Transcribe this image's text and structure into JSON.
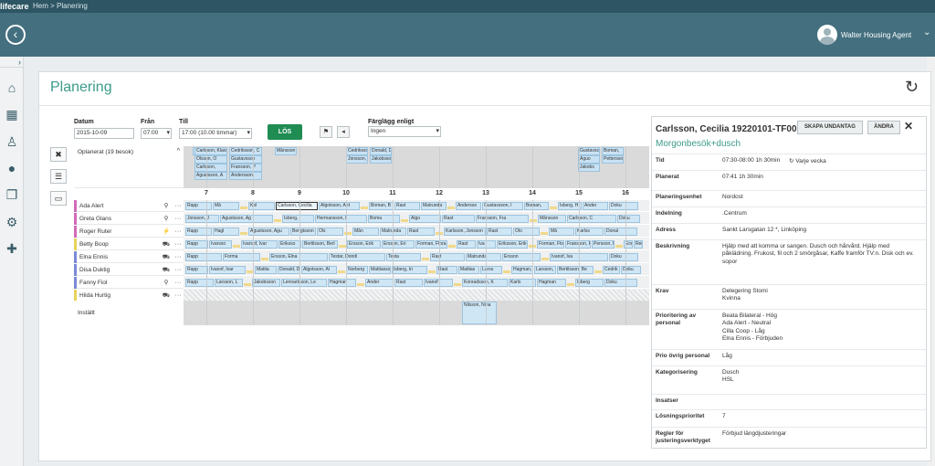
{
  "topbar": {
    "brand": "lifecare",
    "breadcrumb": "Hem  >  Planering"
  },
  "header": {
    "user_name": "Walter Housing Agent"
  },
  "page": {
    "title": "Planering"
  },
  "filters": {
    "datum_label": "Datum",
    "datum_value": "2015-10-09",
    "fran_label": "Från",
    "fran_value": "07:00",
    "till_label": "Till",
    "till_value": "17:00 (10.00 timmar)",
    "los_label": "LÖS",
    "fargsatt_label": "Färglägg enligt",
    "fargsatt_value": "Ingen"
  },
  "schedule": {
    "unplanned_label": "Oplanerat (19 besok)",
    "hours": [
      "7",
      "8",
      "9",
      "10",
      "11",
      "12",
      "13",
      "14",
      "15",
      "16"
    ],
    "installt_label": "Inställt",
    "installt_booking": "Nilsson, Nina",
    "unplanned_blocks": [
      [
        "A",
        "Carlsson, Klara",
        "Cedriksson, C",
        "Olsson, O",
        "Gustavsson",
        "Carlsson,",
        "Fransson, P",
        "Agustsson, A",
        "Andersson"
      ],
      [
        "Månsson"
      ],
      [
        "Cedriksson, C",
        "Donald, Davi",
        "Jonsson, J",
        "Jakobsson, Ja"
      ],
      [
        "Gustavss",
        "Boman,",
        "Aguo",
        "Pettersson",
        "Jakobs"
      ]
    ],
    "staff": [
      {
        "name": "Ada Alert",
        "vehicle": "bike",
        "color": "#d16ab8",
        "bookings": [
          "Rapp",
          "Må",
          "Kol",
          "Carlsson, Cecilia",
          "Algotsson, Ant",
          "Boman, B",
          "Rast",
          "Matrunda",
          "Andersso",
          "Gustavsson, I",
          "Boman,",
          "Isberg, H",
          "Ander",
          "Doku"
        ]
      },
      {
        "name": "Greta Glans",
        "vehicle": "bike",
        "color": "#d16ab8",
        "bookings": [
          "Jonsson, J",
          "Agustsson, Ag",
          "Isberg,",
          "Hermansson, I",
          "Boma",
          "Algo",
          "Rast",
          "Fransson, Fra",
          "Månsson",
          "Carlsson, C",
          "Doku"
        ]
      },
      {
        "name": "Roger Ruter",
        "vehicle": "scooter",
        "color": "#d16ab8",
        "bookings": [
          "Rapp",
          "Hagl",
          "Agustsson, Agu",
          "Bengtsson",
          "Ols",
          "Mån",
          "Matrunda",
          "Rast",
          "Karlsson, Jonsson",
          "Rast",
          "Olo",
          "Må",
          "Karlss",
          "Donal"
        ]
      },
      {
        "name": "Betty Boop",
        "vehicle": "car",
        "color": "#e8d35a",
        "bookings": [
          "Rapp",
          "Ivarsso",
          "Ivarsof, Ivar",
          "Eriksso",
          "Bertilsson, Berl",
          "Ersson, Erik",
          "Ersson, Eri",
          "Forman, Flora",
          "Rast",
          "Iva",
          "Eriksson, Erik",
          "Forman, Flora",
          "Fransson, Frida",
          "Persson, Fr",
          "Ersson, E",
          "Rentni"
        ]
      },
      {
        "name": "Elna Ennis",
        "vehicle": "car",
        "color": "#7b8ad6",
        "bookings": [
          "Rapp",
          "Forma",
          "Ersson, Elna",
          "Testar, Dondi",
          "Testa",
          "Rast",
          "Matrunda",
          "Ersson",
          "Ivanof, Iva",
          "Doku"
        ]
      },
      {
        "name": "Disa Duktig",
        "vehicle": "car",
        "color": "#7b8ad6",
        "bookings": [
          "Rapp",
          "Ivanof, Ivar",
          "Mattia",
          "Donald, D",
          "Algotsson, Al",
          "Norberg",
          "Mattiasso",
          "Isberg, Iri",
          "Rast",
          "Mattias",
          "Larss",
          "Hagman,",
          "Larsson,",
          "Bertilsson, Be",
          "Cedrik",
          "Doku"
        ]
      },
      {
        "name": "Fanny Fiol",
        "vehicle": "bike",
        "color": "#7b8ad6",
        "bookings": [
          "Rapp",
          "Larsson, L",
          "Jakobsson",
          "Lennartsson, Le",
          "Hagman",
          "Ander",
          "Rast",
          "Ivanof",
          "Konradsson, K",
          "Karls",
          "Hagman",
          "Isberg",
          "Doku"
        ]
      },
      {
        "name": "Hilda Hurtig",
        "vehicle": "car",
        "color": "#e8d35a",
        "bookings": []
      }
    ]
  },
  "detail": {
    "title": "Carlsson, Cecilia 19220101-TF00",
    "subtitle": "Morgonbesök+dusch",
    "skapa_undantag": "SKAPA UNDANTAG",
    "andra": "ÄNDRA",
    "rows": [
      {
        "key": "Tid",
        "lines": [
          "07:30-08:00   1h 30min"
        ],
        "extra": "Varje vecka"
      },
      {
        "key": "Planerat",
        "lines": [
          "07:41   1h 30min"
        ]
      },
      {
        "key": "Planeringsenhet",
        "lines": [
          "Nordost"
        ]
      },
      {
        "key": "Indelning",
        "lines": [
          ".Centrum"
        ]
      },
      {
        "key": "Adress",
        "lines": [
          "Sankt Larsgatan 12 *, Linköping"
        ]
      },
      {
        "key": "Beskrivning",
        "lines": [
          "Hjälp med att komma ur sangen. Dusch och hårvård. Hjälp med påklädning. Frukost, fil och 2 smörgåsar, Kaffe framför TV:n. Disk och ev. sopor"
        ]
      },
      {
        "key": "Krav",
        "lines": [
          "Delegering Stomi",
          "Kvinna"
        ]
      },
      {
        "key": "Prioritering av personal",
        "lines": [
          "Beata Bilateral - Hög",
          "Ada Alert - Neutral",
          "Cilla Coop - Låg",
          "Elna Ennis - Förbjuden"
        ]
      },
      {
        "key": "Prio övrig personal",
        "lines": [
          "Låg"
        ]
      },
      {
        "key": "Kategorisering",
        "lines": [
          "Dusch",
          "HSL"
        ]
      },
      {
        "key": "Insatser",
        "lines": []
      },
      {
        "key": "Lösningsprioritet",
        "lines": [
          "7"
        ]
      },
      {
        "key": "Regler för justeringsverktyget",
        "lines": [
          "Förbjud längdjusteringar"
        ]
      }
    ]
  }
}
